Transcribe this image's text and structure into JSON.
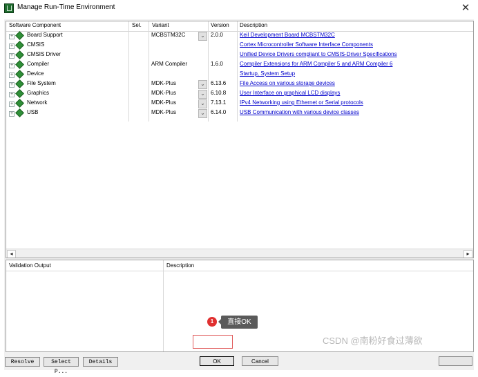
{
  "window": {
    "title": "Manage Run-Time Environment",
    "close_glyph": "✕"
  },
  "table": {
    "headers": [
      "Software Component",
      "Sel.",
      "Variant",
      "Version",
      "Description"
    ],
    "rows": [
      {
        "name": "Board Support",
        "variant": "MCBSTM32C",
        "dropdown": true,
        "version": "2.0.0",
        "description": "Keil Development Board MCBSTM32C"
      },
      {
        "name": "CMSIS",
        "variant": "",
        "dropdown": false,
        "version": "",
        "description": "Cortex Microcontroller Software Interface Components"
      },
      {
        "name": "CMSIS Driver",
        "variant": "",
        "dropdown": false,
        "version": "",
        "description": "Unified Device Drivers compliant to CMSIS-Driver Specifications"
      },
      {
        "name": "Compiler",
        "variant": "ARM Compiler",
        "dropdown": false,
        "version": "1.6.0",
        "description": "Compiler Extensions for ARM Compiler 5 and ARM Compiler 6"
      },
      {
        "name": "Device",
        "variant": "",
        "dropdown": false,
        "version": "",
        "description": "Startup, System Setup"
      },
      {
        "name": "File System",
        "variant": "MDK-Plus",
        "dropdown": true,
        "version": "6.13.6",
        "description": "File Access on various storage devices"
      },
      {
        "name": "Graphics",
        "variant": "MDK-Plus",
        "dropdown": true,
        "version": "6.10.8",
        "description": "User Interface on graphical LCD displays"
      },
      {
        "name": "Network",
        "variant": "MDK-Plus",
        "dropdown": true,
        "version": "7.13.1",
        "description": "IPv4 Networking using Ethernet or Serial protocols"
      },
      {
        "name": "USB",
        "variant": "MDK-Plus",
        "dropdown": true,
        "version": "6.14.0",
        "description": "USB Communication with various device classes"
      }
    ]
  },
  "validation": {
    "output_header": "Validation Output",
    "description_header": "Description"
  },
  "buttons": {
    "resolve": "Resolve",
    "select_packs": "Select P...",
    "details": "Details",
    "ok": "OK",
    "cancel": "Cancel"
  },
  "annotation": {
    "number": "1",
    "text": "直接OK"
  },
  "watermark": "CSDN @南粉好食过薄欲",
  "colors": {
    "link": "#0000cc",
    "highlight": "#e05a5a",
    "component_icon": "#2f8f38"
  }
}
